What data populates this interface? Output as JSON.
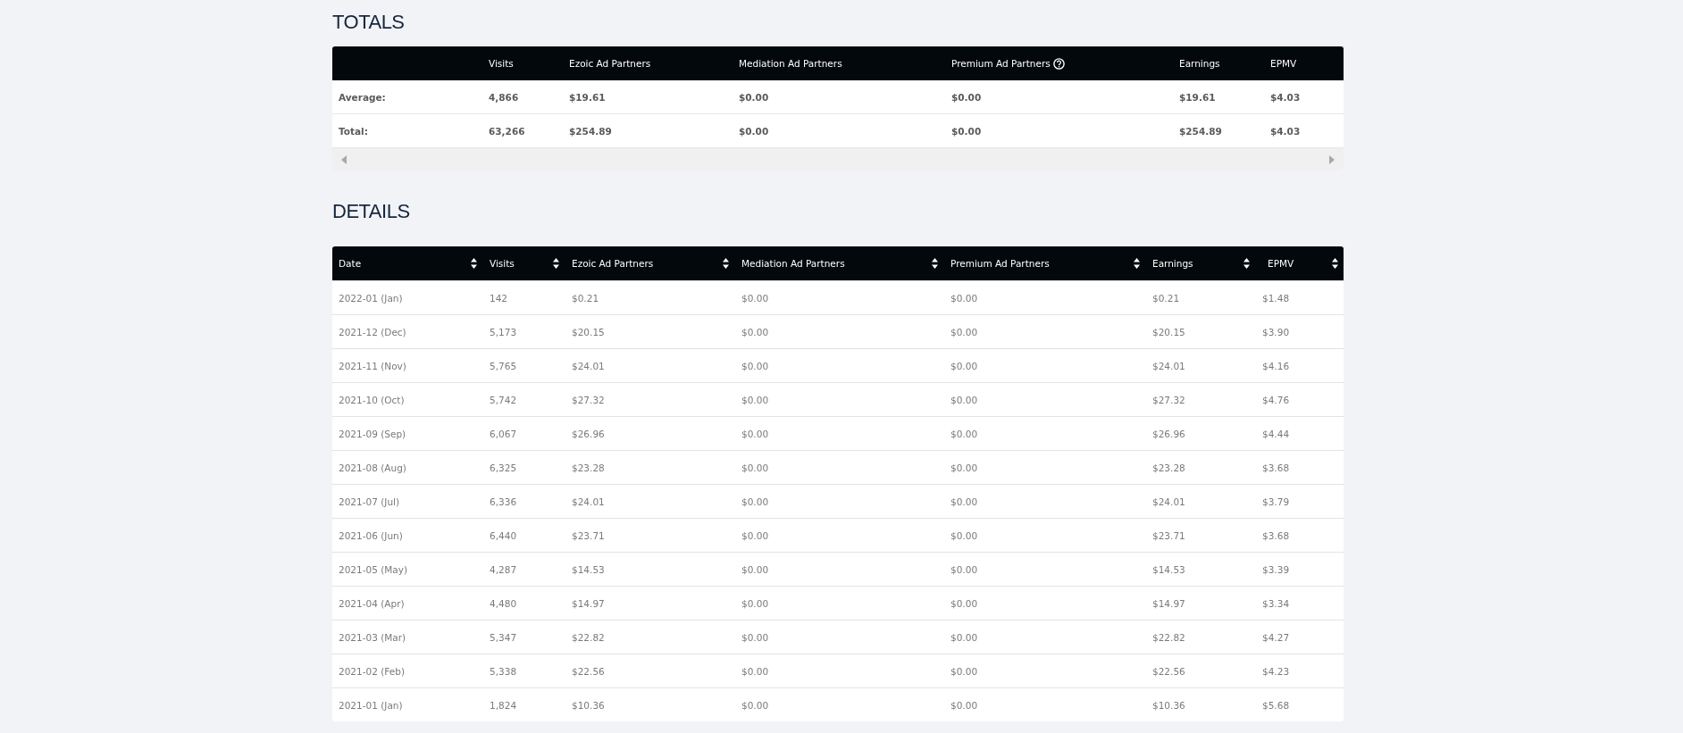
{
  "totals": {
    "title": "TOTALS",
    "columns": [
      "",
      "Visits",
      "Ezoic Ad Partners",
      "Mediation Ad Partners",
      "Premium Ad Partners",
      "Earnings",
      "EPMV"
    ],
    "rows": [
      [
        "Average:",
        "4,866",
        "$19.61",
        "$0.00",
        "$0.00",
        "$19.61",
        "$4.03"
      ],
      [
        "Total:",
        "63,266",
        "$254.89",
        "$0.00",
        "$0.00",
        "$254.89",
        "$4.03"
      ]
    ]
  },
  "details": {
    "title": "DETAILS",
    "columns": [
      "Date",
      "Visits",
      "Ezoic Ad Partners",
      "Mediation Ad Partners",
      "Premium Ad Partners",
      "Earnings",
      "EPMV"
    ],
    "rows": [
      [
        "2022-01 (Jan)",
        "142",
        "$0.21",
        "$0.00",
        "$0.00",
        "$0.21",
        "$1.48"
      ],
      [
        "2021-12 (Dec)",
        "5,173",
        "$20.15",
        "$0.00",
        "$0.00",
        "$20.15",
        "$3.90"
      ],
      [
        "2021-11 (Nov)",
        "5,765",
        "$24.01",
        "$0.00",
        "$0.00",
        "$24.01",
        "$4.16"
      ],
      [
        "2021-10 (Oct)",
        "5,742",
        "$27.32",
        "$0.00",
        "$0.00",
        "$27.32",
        "$4.76"
      ],
      [
        "2021-09 (Sep)",
        "6,067",
        "$26.96",
        "$0.00",
        "$0.00",
        "$26.96",
        "$4.44"
      ],
      [
        "2021-08 (Aug)",
        "6,325",
        "$23.28",
        "$0.00",
        "$0.00",
        "$23.28",
        "$3.68"
      ],
      [
        "2021-07 (Jul)",
        "6,336",
        "$24.01",
        "$0.00",
        "$0.00",
        "$24.01",
        "$3.79"
      ],
      [
        "2021-06 (Jun)",
        "6,440",
        "$23.71",
        "$0.00",
        "$0.00",
        "$23.71",
        "$3.68"
      ],
      [
        "2021-05 (May)",
        "4,287",
        "$14.53",
        "$0.00",
        "$0.00",
        "$14.53",
        "$3.39"
      ],
      [
        "2021-04 (Apr)",
        "4,480",
        "$14.97",
        "$0.00",
        "$0.00",
        "$14.97",
        "$3.34"
      ],
      [
        "2021-03 (Mar)",
        "5,347",
        "$22.82",
        "$0.00",
        "$0.00",
        "$22.82",
        "$4.27"
      ],
      [
        "2021-02 (Feb)",
        "5,338",
        "$22.56",
        "$0.00",
        "$0.00",
        "$22.56",
        "$4.23"
      ],
      [
        "2021-01 (Jan)",
        "1,824",
        "$10.36",
        "$0.00",
        "$0.00",
        "$10.36",
        "$5.68"
      ]
    ]
  }
}
